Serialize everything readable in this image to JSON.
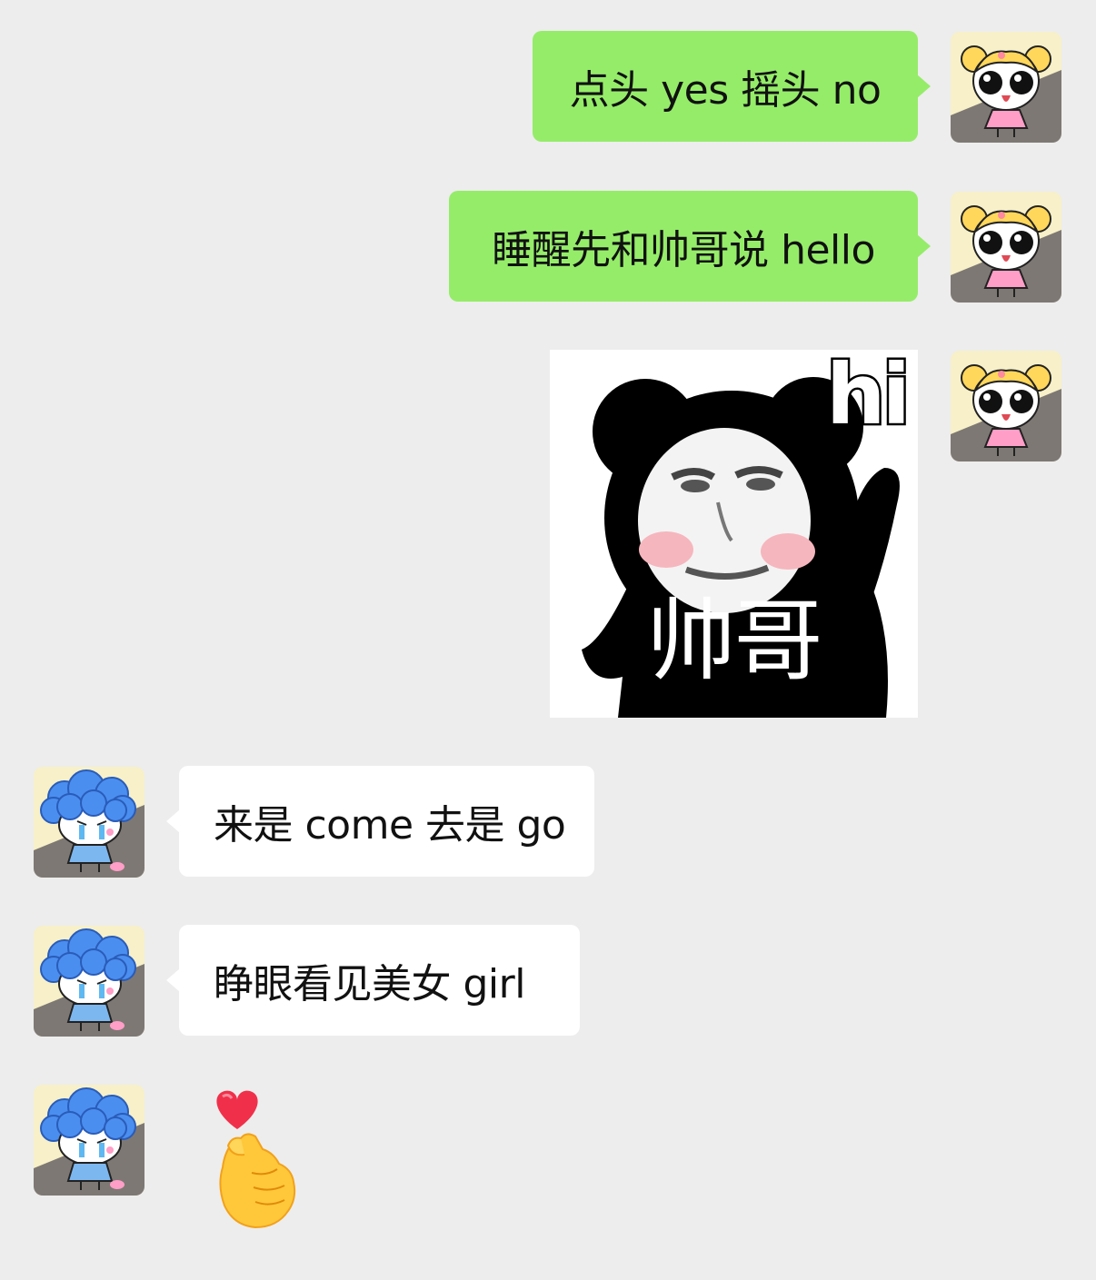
{
  "messages": [
    {
      "side": "sent",
      "type": "text",
      "text": "点头 yes 摇头 no",
      "avatar": "girl-avatar"
    },
    {
      "side": "sent",
      "type": "text",
      "text": "睡醒先和帅哥说 hello",
      "avatar": "girl-avatar"
    },
    {
      "side": "sent",
      "type": "sticker",
      "sticker_text_top": "hi",
      "sticker_text_bottom": "帅哥",
      "avatar": "girl-avatar"
    },
    {
      "side": "received",
      "type": "text",
      "text": "来是 come 去是 go",
      "avatar": "boy-avatar"
    },
    {
      "side": "received",
      "type": "text",
      "text": "睁眼看见美女 girl",
      "avatar": "boy-avatar"
    },
    {
      "side": "received",
      "type": "emoji",
      "emoji": "finger-heart-emoji",
      "avatar": "boy-avatar"
    }
  ],
  "colors": {
    "background": "#ededed",
    "sent_bubble": "#95ec69",
    "received_bubble": "#ffffff",
    "text": "#111111"
  }
}
